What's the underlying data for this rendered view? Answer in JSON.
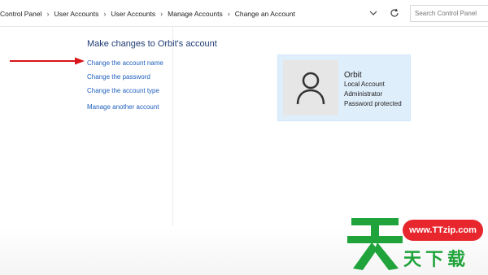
{
  "breadcrumb": [
    "Control Panel",
    "User Accounts",
    "User Accounts",
    "Manage Accounts",
    "Change an Account"
  ],
  "search": {
    "placeholder": "Search Control Panel"
  },
  "main": {
    "heading": "Make changes to Orbit's account",
    "links": {
      "change_name": "Change the account name",
      "change_password": "Change the password",
      "change_type": "Change the account type",
      "manage_another": "Manage another account"
    }
  },
  "account": {
    "name": "Orbit",
    "type": "Local Account",
    "role": "Administrator",
    "status": "Password protected"
  },
  "watermark": {
    "url": "www.TTzip.com",
    "chars": "天下载"
  },
  "colors": {
    "link": "#1f5fbf",
    "heading": "#1f3b73",
    "arrow": "#d9141b",
    "watermark_green": "#1fa33a",
    "watermark_red": "#e8262e"
  },
  "icons": [
    "chevron-down-icon",
    "refresh-icon",
    "user-avatar-icon",
    "arrow-pointer",
    "watermark-logo"
  ]
}
